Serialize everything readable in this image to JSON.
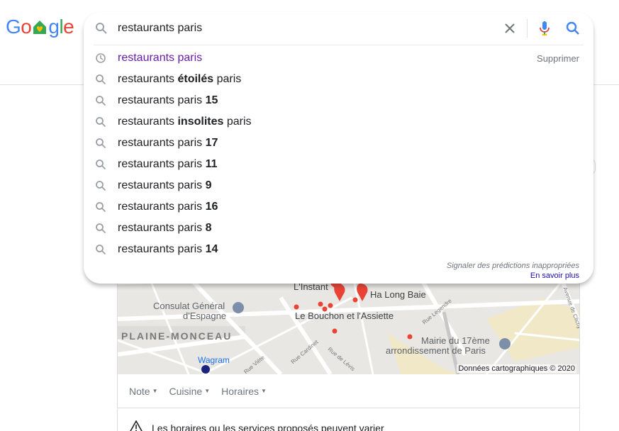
{
  "logo": {
    "letters": [
      "G",
      "o",
      "",
      "g",
      "l",
      "e"
    ],
    "colors": [
      "#4285f4",
      "#ea4335",
      "#34a853",
      "#4285f4",
      "#34a853",
      "#ea4335"
    ]
  },
  "search": {
    "query": "restaurants paris",
    "clear_icon": "close-icon",
    "mic_icon": "mic-icon",
    "search_icon": "search-icon"
  },
  "suggestions": [
    {
      "type": "history",
      "plain": "restaurants paris",
      "bold": "",
      "after": "",
      "remove": "Supprimer"
    },
    {
      "type": "search",
      "plain": "restaurants ",
      "bold": "étoilés",
      "after": " paris"
    },
    {
      "type": "search",
      "plain": "restaurants paris ",
      "bold": "15",
      "after": ""
    },
    {
      "type": "search",
      "plain": "restaurants ",
      "bold": "insolites",
      "after": " paris"
    },
    {
      "type": "search",
      "plain": "restaurants paris ",
      "bold": "17",
      "after": ""
    },
    {
      "type": "search",
      "plain": "restaurants paris ",
      "bold": "11",
      "after": ""
    },
    {
      "type": "search",
      "plain": "restaurants paris ",
      "bold": "9",
      "after": ""
    },
    {
      "type": "search",
      "plain": "restaurants paris ",
      "bold": "16",
      "after": ""
    },
    {
      "type": "search",
      "plain": "restaurants paris ",
      "bold": "8",
      "after": ""
    },
    {
      "type": "search",
      "plain": "restaurants paris ",
      "bold": "14",
      "after": ""
    }
  ],
  "footer": {
    "report": "Signaler des prédictions inappropriées",
    "learn_more": "En savoir plus"
  },
  "map": {
    "labels": {
      "instant": "L'Instant",
      "halong": "Ha Long Baie",
      "consulat_1": "Consulat Général",
      "consulat_2": "d'Espagne",
      "bouchon": "Le Bouchon et l'Assiette",
      "plaine": "PLAINE-MONCEAU",
      "mairie_1": "Mairie du 17ème",
      "mairie_2": "arrondissement de Paris",
      "wagram": "Wagram",
      "rue_viete": "Rue Viète",
      "rue_cardinet": "Rue Cardinet",
      "rue_levis": "Rue de Lévis",
      "rue_legendre": "Rue Legendre",
      "avenue_clichy": "Avenue de Clichy"
    },
    "credit": "Données cartographiques © 2020"
  },
  "filters": [
    {
      "label": "Note"
    },
    {
      "label": "Cuisine"
    },
    {
      "label": "Horaires"
    }
  ],
  "notice": "Les horaires ou les services proposés peuvent varier"
}
